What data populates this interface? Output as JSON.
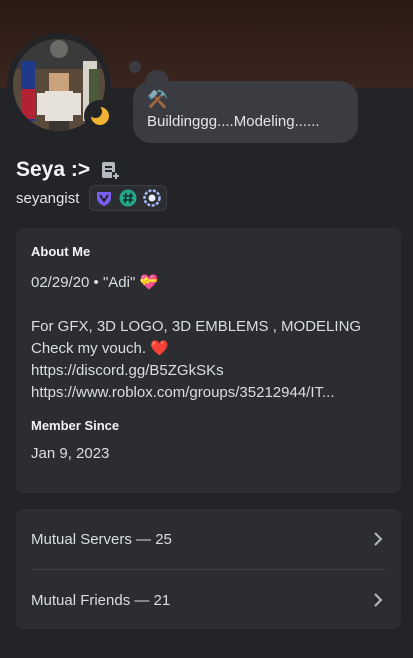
{
  "profile": {
    "display_name": "Seya :>",
    "username": "seyangist",
    "status_emoji": "⚒️",
    "custom_status": "Buildinggg....Modeling......",
    "badges": [
      "hypesquad-balance-icon",
      "hashtag-badge-icon",
      "nitro-laurel-icon"
    ]
  },
  "about": {
    "title": "About Me",
    "line1_text": "02/29/20 • \"Adi\"",
    "line1_emoji": "💝",
    "line2": "For GFX, 3D LOGO, 3D EMBLEMS , MODELING",
    "line3_text": "Check my vouch.",
    "line3_emoji": "❤️",
    "link1": "https://discord.gg/B5ZGkSKs",
    "link2": "https://www.roblox.com/groups/35212944/IT..."
  },
  "member_since": {
    "title": "Member Since",
    "date": "Jan 9, 2023"
  },
  "mutuals": {
    "servers_label": "Mutual Servers — 25",
    "friends_label": "Mutual Friends — 21"
  },
  "colors": {
    "background": "#232428",
    "card": "#2b2d31",
    "link": "#00a8fc",
    "idle": "#f0b232"
  }
}
